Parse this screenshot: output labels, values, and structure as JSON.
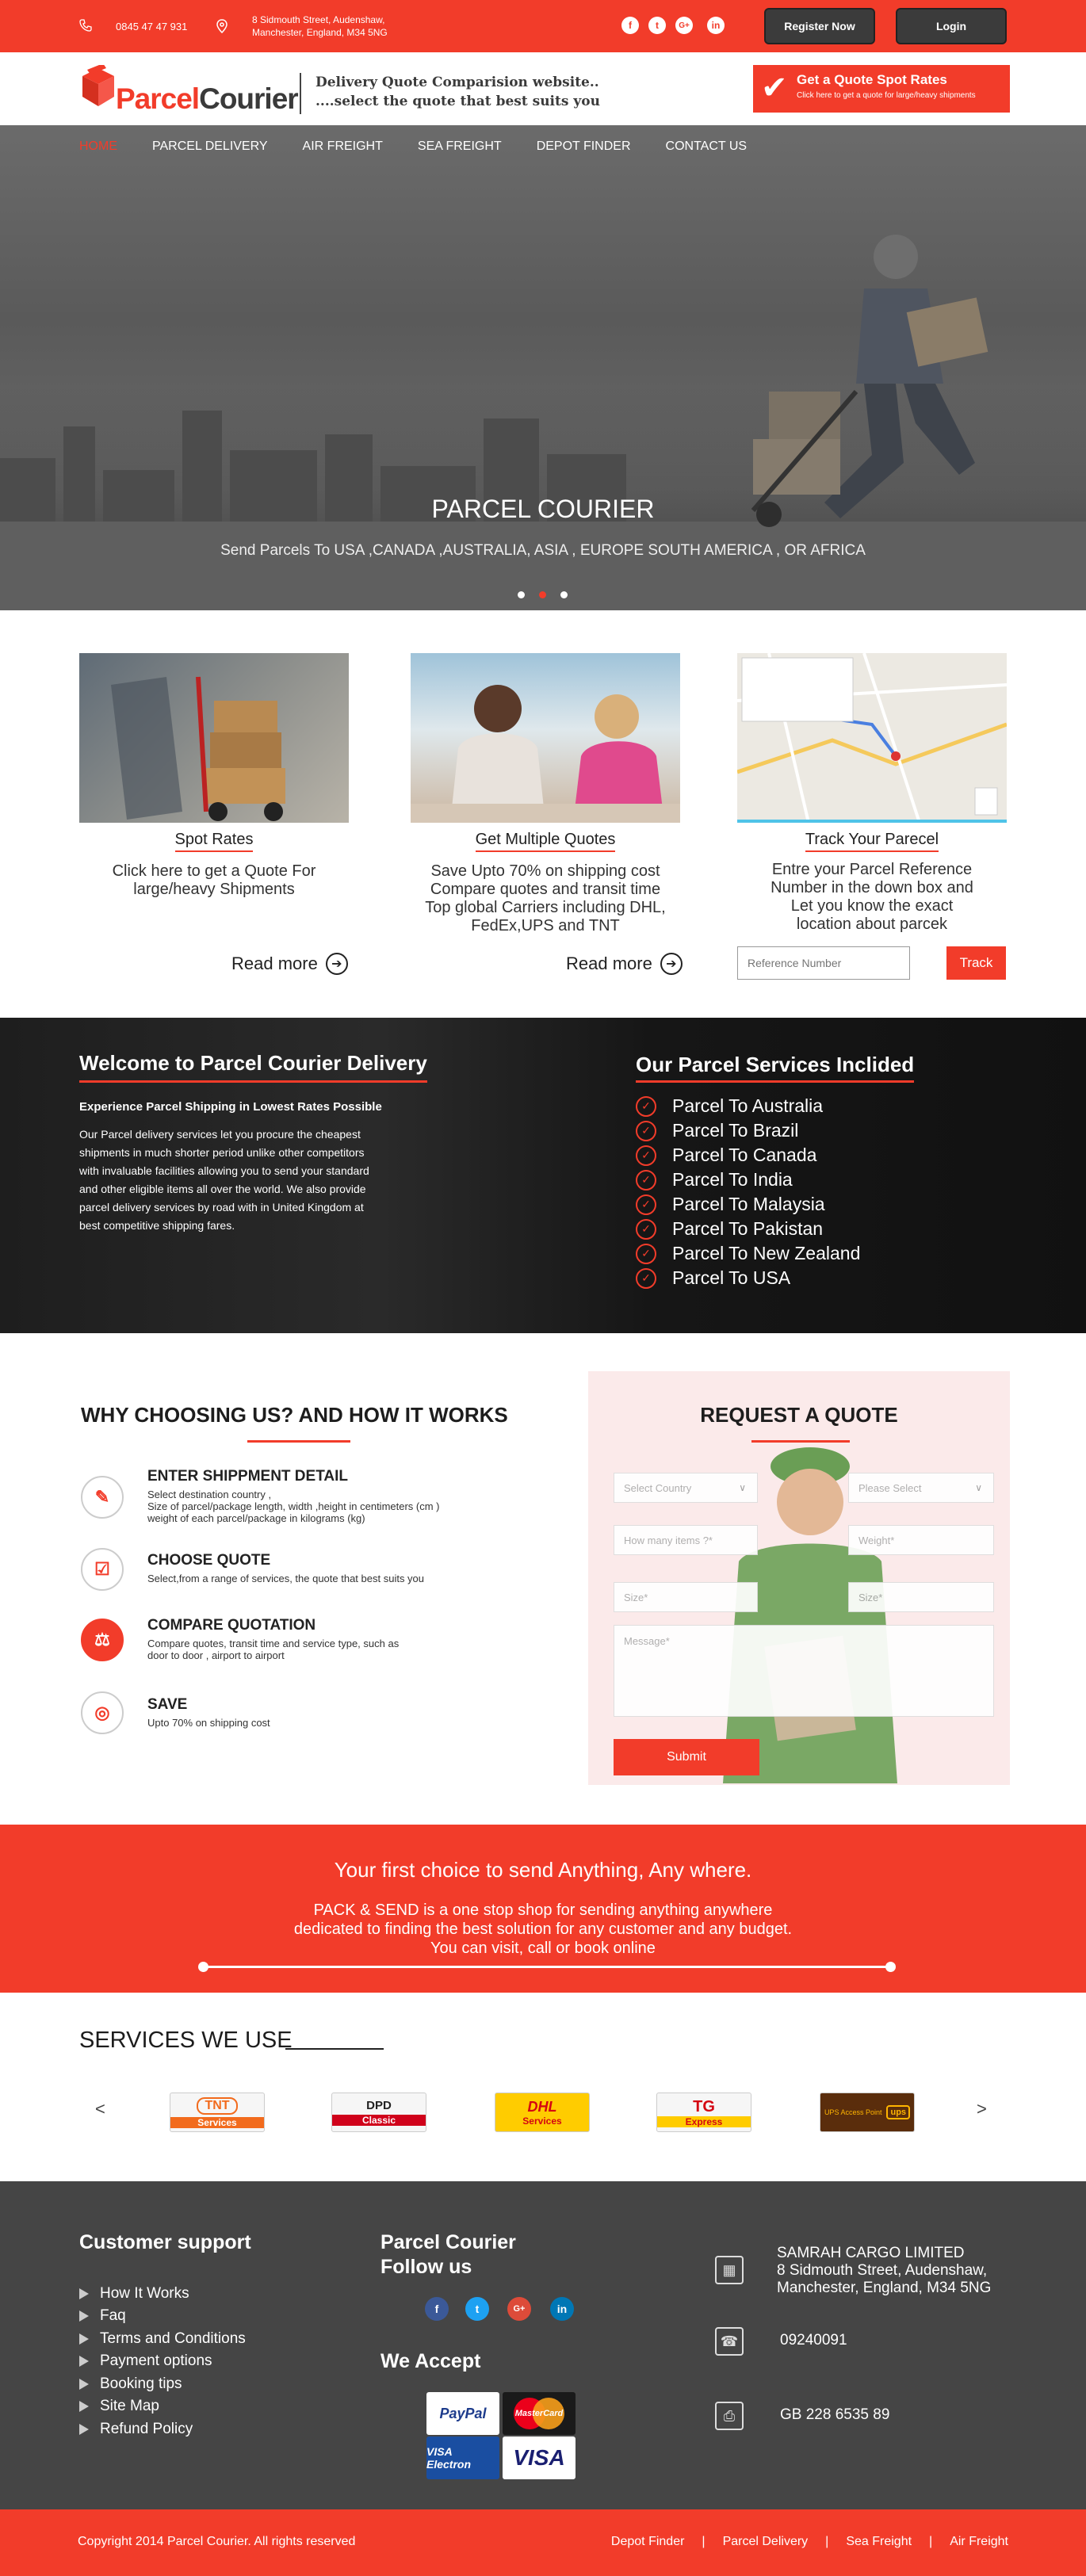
{
  "topbar": {
    "phone": "0845 47 47 931",
    "address_line1": "8 Sidmouth Street, Audenshaw,",
    "address_line2": "Manchester, England, M34 5NG",
    "social": [
      "f",
      "t",
      "G+",
      "in"
    ],
    "register_label": "Register Now",
    "login_label": "Login"
  },
  "header": {
    "logo_part1": "Parcel",
    "logo_part2": "Courier",
    "tagline_line1": "Delivery Quote Comparision website..",
    "tagline_line2": "....select the quote that best suits you",
    "cta_title": "Get a Quote Spot Rates",
    "cta_sub": "Click here to get a quote for large/heavy shipments"
  },
  "nav": [
    "HOME",
    "PARCEL DELIVERY",
    "AIR FREIGHT",
    "SEA FREIGHT",
    "DEPOT FINDER",
    "CONTACT US"
  ],
  "hero": {
    "title": "PARCEL COURIER",
    "subtitle": "Send Parcels To USA ,CANADA ,AUSTRALIA, ASIA , EUROPE SOUTH AMERICA , OR AFRICA",
    "active_slide": 2,
    "slides": 3
  },
  "cards": [
    {
      "title": "Spot Rates",
      "text": [
        "Click here to get a Quote For",
        "large/heavy Shipments"
      ],
      "readmore": "Read more"
    },
    {
      "title": "Get Multiple Quotes",
      "text": [
        "Save Upto 70% on shipping cost",
        "Compare quotes and transit time",
        "Top global Carriers including DHL,",
        "FedEx,UPS and TNT"
      ],
      "readmore": "Read more"
    },
    {
      "title": "Track Your Parecel",
      "text": [
        "Entre your Parcel Reference",
        "Number in the down box and",
        "Let you know the exact",
        "location about parcek"
      ],
      "placeholder": "Reference Number",
      "track_label": "Track"
    }
  ],
  "welcome": {
    "title": "Welcome to Parcel Courier Delivery",
    "subtitle": "Experience Parcel Shipping in Lowest Rates Possible",
    "paragraph": "Our Parcel delivery services let you procure the cheapest shipments in much shorter period unlike other competitors with invaluable facilities allowing you to send your standard and other eligible items all over the world. We also provide parcel delivery services by road with in United Kingdom at best competitive shipping fares.",
    "services_title": "Our Parcel Services Inclided",
    "services": [
      "Parcel To Australia",
      "Parcel To Brazil",
      "Parcel To Canada",
      "Parcel To India",
      "Parcel To Malaysia",
      "Parcel To Pakistan",
      "Parcel To New Zealand",
      "Parcel To USA"
    ]
  },
  "why": {
    "title": "WHY CHOOSING US? AND HOW IT WORKS",
    "steps": [
      {
        "heading": "ENTER SHIPPMENT DETAIL",
        "lines": [
          "Select destination country ,",
          "Size of parcel/package length, width ,height in centimeters (cm )",
          "weight of each parcel/package in kilograms (kg)"
        ]
      },
      {
        "heading": "CHOOSE QUOTE",
        "lines": [
          "Select,from a range of services, the quote that best suits you"
        ]
      },
      {
        "heading": "COMPARE QUOTATION",
        "lines": [
          "Compare quotes, transit time and service type, such as",
          "door to door , airport to airport"
        ]
      },
      {
        "heading": "SAVE",
        "lines": [
          "Upto 70% on shipping cost"
        ]
      }
    ]
  },
  "quote_form": {
    "title": "REQUEST A QUOTE",
    "country_placeholder": "Select Country",
    "select_placeholder": "Please Select",
    "items_placeholder": "How many items ?*",
    "weight_placeholder": "Weight*",
    "size1_placeholder": "Size*",
    "size2_placeholder": "Size*",
    "message_placeholder": "Message*",
    "submit_label": "Submit"
  },
  "choice": {
    "title": "Your first choice to send Anything, Any where.",
    "line1": "PACK & SEND is a one stop shop for sending anything anywhere",
    "line2": "dedicated to finding the best solution for any customer and any budget.",
    "line3": "You can visit, call or book online"
  },
  "services_use": {
    "title": "SERVICES WE USE",
    "prev": "<",
    "next": ">",
    "brands": [
      {
        "name": "TNT",
        "label": "Services"
      },
      {
        "name": "DPD",
        "label": "Classic"
      },
      {
        "name": "DHL",
        "label": "Services"
      },
      {
        "name": "TG",
        "label": "Express"
      },
      {
        "name": "UPS Access Point",
        "label": "ups"
      }
    ]
  },
  "footer": {
    "support_title": "Customer support",
    "support_links": [
      "How It Works",
      "Faq",
      "Terms and Conditions",
      "Payment options",
      "Booking tips",
      "Site Map",
      "Refund Policy"
    ],
    "follow_title_line1": "Parcel Courier",
    "follow_title_line2": "Follow us",
    "follow_social": [
      "f",
      "t",
      "G+",
      "in"
    ],
    "accept_title": "We Accept",
    "cards": [
      "PayPal",
      "MasterCard",
      "VISA Electron",
      "VISA"
    ],
    "company": "SAMRAH CARGO LIMITED",
    "company_addr1": "8 Sidmouth Street, Audenshaw,",
    "company_addr2": "Manchester, England, M34 5NG",
    "phone": "09240091",
    "vat": "GB 228 6535 89"
  },
  "bottom": {
    "copyright": "Copyright 2014 Parcel Courier. All rights reserved",
    "links": [
      "Depot Finder",
      "Parcel Delivery",
      "Sea Freight",
      "Air Freight"
    ]
  },
  "colors": {
    "accent": "#f23c2a",
    "dark": "#454545"
  }
}
